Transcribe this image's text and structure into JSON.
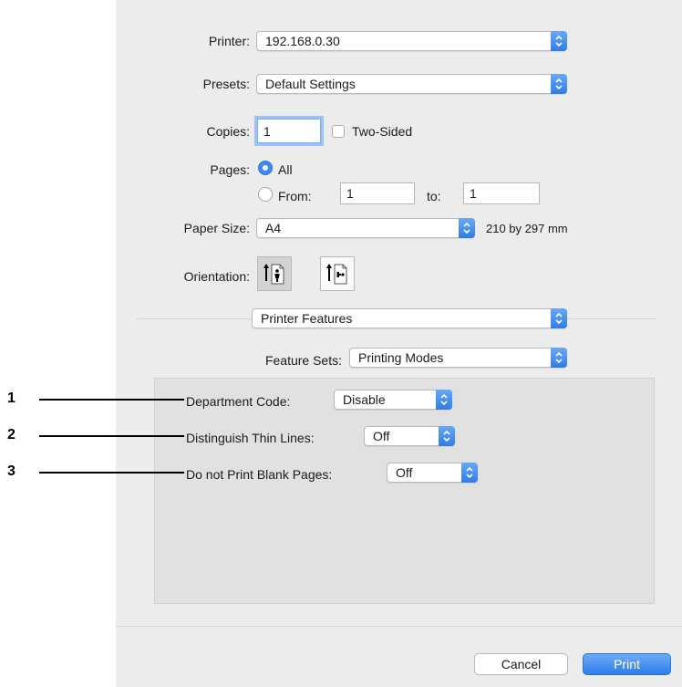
{
  "printer": {
    "label": "Printer:",
    "value": "192.168.0.30"
  },
  "presets": {
    "label": "Presets:",
    "value": "Default Settings"
  },
  "copies": {
    "label": "Copies:",
    "value": "1",
    "two_sided_label": "Two-Sided"
  },
  "pages": {
    "label": "Pages:",
    "all_label": "All",
    "from_label": "From:",
    "from_value": "1",
    "to_label": "to:",
    "to_value": "1"
  },
  "paper_size": {
    "label": "Paper Size:",
    "value": "A4",
    "dimensions": "210 by 297 mm"
  },
  "orientation": {
    "label": "Orientation:"
  },
  "section_popup": {
    "value": "Printer Features"
  },
  "feature_sets": {
    "label": "Feature Sets:",
    "value": "Printing Modes"
  },
  "features": [
    {
      "callout": "1",
      "label": "Department Code:",
      "value": "Disable"
    },
    {
      "callout": "2",
      "label": "Distinguish Thin Lines:",
      "value": "Off"
    },
    {
      "callout": "3",
      "label": "Do not Print Blank Pages:",
      "value": "Off"
    }
  ],
  "buttons": {
    "cancel": "Cancel",
    "print": "Print"
  },
  "colors": {
    "accent": "#3b88ee",
    "window_bg": "#ececec",
    "panel_bg": "#e1e1e1"
  }
}
